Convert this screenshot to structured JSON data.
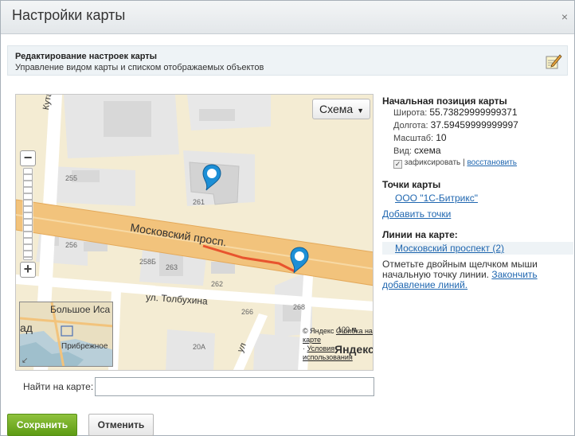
{
  "dialog": {
    "title": "Настройки карты",
    "close_glyph": "×"
  },
  "header": {
    "title": "Редактирование настроек карты",
    "subtitle": "Управление видом карты и списком отображаемых объектов",
    "icon": "edit-note-icon"
  },
  "map": {
    "type_button": "Схема",
    "dropdown_glyph": "▼",
    "street_labels": {
      "moskovsky": "Московский просп.",
      "tolbukhina": "ул. Толбухина",
      "kutaisskaya": "Кутаисская",
      "ul": "ул"
    },
    "building_labels": [
      "255",
      "256",
      "258Б",
      "263",
      "262",
      "266",
      "268",
      "20А",
      "261"
    ],
    "minimap_labels": {
      "bolshoe": "Большое Иса",
      "pribrezhnoe": "Прибрежное",
      "ad": "ад"
    },
    "scale": "100 м",
    "copyright": {
      "yandex": "© Яндекс",
      "report_error": "Ошибка на карте",
      "terms": "Условия использования",
      "logo": "Яндекс"
    },
    "colors": {
      "main_road": "#f2c37c",
      "background": "#f4ecd3",
      "building": "#d8d8d8",
      "pin": "#1d8fd6",
      "line": "#e8542e"
    }
  },
  "sidebar": {
    "initial_position": {
      "heading": "Начальная позиция карты",
      "lat_label": "Широта:",
      "lat_value": "55.73829999999371",
      "lon_label": "Долгота:",
      "lon_value": "37.59459999999997",
      "scale_label": "Масштаб:",
      "scale_value": "10",
      "view_label": "Вид:",
      "view_value": "схема",
      "fixed_label": "зафиксировать",
      "separator": "|",
      "restore_label": "восстановить"
    },
    "points": {
      "heading": "Точки карты",
      "items": [
        "ООО \"1С-Битрикс\""
      ],
      "add_label": "Добавить точки"
    },
    "lines": {
      "heading": "Линии на карте:",
      "items": [
        "Московский проспект (2)"
      ],
      "hint": "Отметьте двойным щелчком мыши начальную точку линии.",
      "finish_label": "Закончить добавление линий."
    }
  },
  "search": {
    "label": "Найти на карте:",
    "value": "",
    "placeholder": ""
  },
  "buttons": {
    "save": "Сохранить",
    "cancel": "Отменить"
  }
}
